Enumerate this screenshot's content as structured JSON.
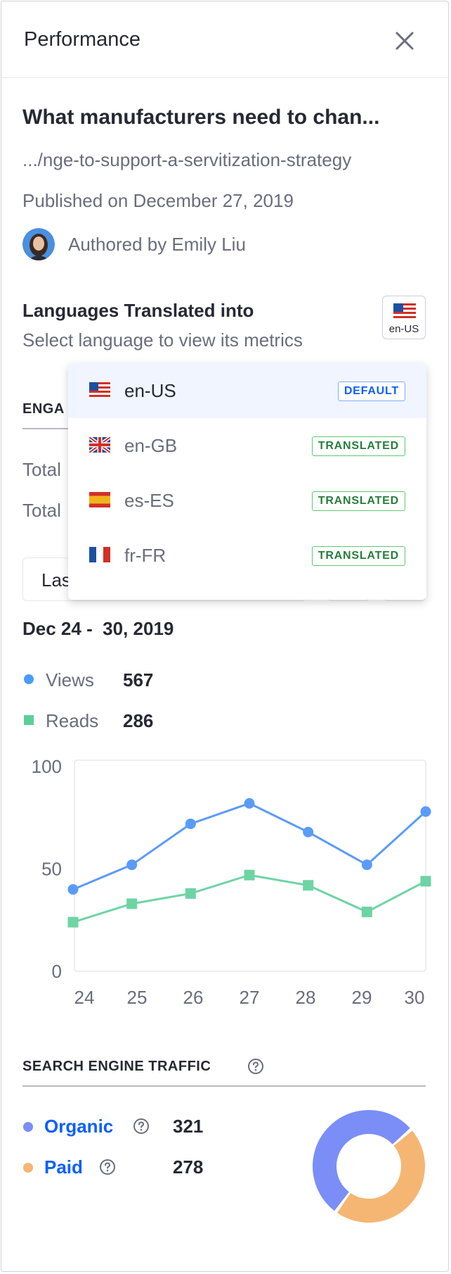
{
  "panel": {
    "title": "Performance"
  },
  "article": {
    "title": "What manufacturers need to chan...",
    "url": ".../nge-to-support-a-servitization-strategy",
    "published": "Published on December 27, 2019",
    "author": "Authored by Emily Liu"
  },
  "languages": {
    "title": "Languages Translated into",
    "subtitle": "Select language to view its metrics",
    "selected": "en-US",
    "items": [
      {
        "code": "en-US",
        "flag": "us-flag-icon",
        "badge": "DEFAULT"
      },
      {
        "code": "en-GB",
        "flag": "uk-flag-icon",
        "badge": "TRANSLATED"
      },
      {
        "code": "es-ES",
        "flag": "es-flag-icon",
        "badge": "TRANSLATED"
      },
      {
        "code": "fr-FR",
        "flag": "fr-flag-icon",
        "badge": "TRANSLATED"
      }
    ]
  },
  "engagement": {
    "heading_visible": "ENGA",
    "total_views_visible": "Total",
    "total_reads_visible": "Total",
    "range_visible": "Las"
  },
  "traffic": {
    "date_range": "Dec 24 -  30, 2019",
    "legend": [
      {
        "label": "Views",
        "value": "567",
        "color": "#4b9bff"
      },
      {
        "label": "Reads",
        "value": "286",
        "color": "#5ccf97"
      }
    ]
  },
  "chart_data": {
    "type": "line",
    "x": [
      "24",
      "25",
      "26",
      "27",
      "28",
      "29",
      "30"
    ],
    "ylim": [
      0,
      100
    ],
    "yticks": [
      "100",
      "50",
      "0"
    ],
    "series": [
      {
        "name": "Views",
        "values": [
          40,
          52,
          72,
          82,
          68,
          52,
          78
        ],
        "color": "#5b9bf8"
      },
      {
        "name": "Reads",
        "values": [
          24,
          33,
          38,
          47,
          42,
          29,
          44
        ],
        "color": "#6ed4a4"
      }
    ],
    "grid": false
  },
  "search": {
    "heading": "SEARCH ENGINE TRAFFIC",
    "items": [
      {
        "label": "Organic",
        "value": "321",
        "color": "#7b8ef7"
      },
      {
        "label": "Paid",
        "value": "278",
        "color": "#f5b674"
      }
    ]
  },
  "icons": {
    "close": "close-icon",
    "help": "question-circle-icon"
  }
}
